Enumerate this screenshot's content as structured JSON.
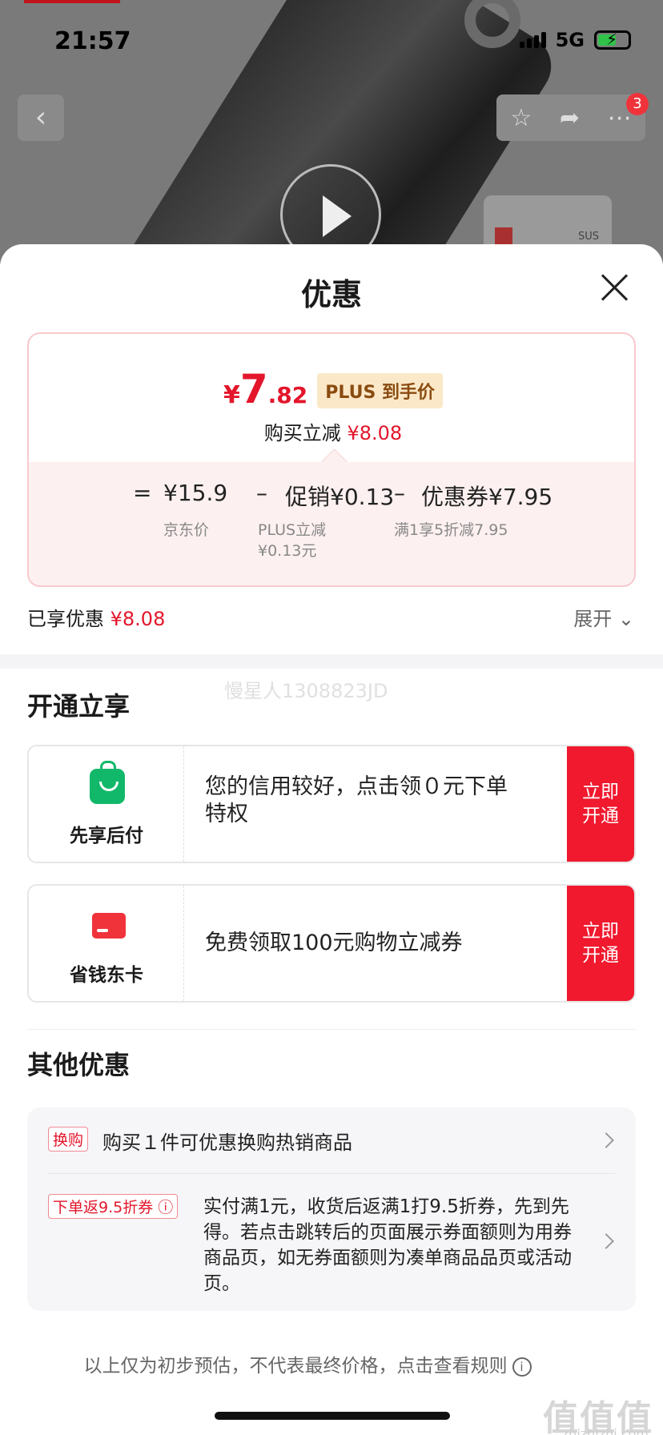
{
  "status_bar": {
    "time": "21:57",
    "network": "5G"
  },
  "product_page": {
    "cart_count": "3",
    "thumb_text": "SUS"
  },
  "sheet": {
    "title": "优惠",
    "price": {
      "currency": "¥",
      "integer": "7",
      "decimal": ".82",
      "tag": "PLUS 到手价"
    },
    "save_label": "购买立减",
    "save_amount": "¥8.08",
    "formula": {
      "equals": "=",
      "base": "¥15.9",
      "minus1": "–",
      "promo": "促销¥0.13",
      "minus2": "–",
      "coupon": "优惠券¥7.95",
      "base_sub": "京东价",
      "promo_sub_1": "PLUS立减",
      "promo_sub_2": "¥0.13元",
      "coupon_sub": "满1享5折减7.95"
    },
    "enjoyed_label": "已享优惠",
    "enjoyed_amount": "¥8.08",
    "expand_label": "展开",
    "watermark": "慢星人1308823JD"
  },
  "open_section": {
    "title": "开通立享",
    "offers": [
      {
        "name": "先享后付",
        "desc": "您的信用较好，点击领０元下单特权",
        "btn_line1": "立即",
        "btn_line2": "开通",
        "icon": "shopping-bag-icon"
      },
      {
        "name": "省钱东卡",
        "desc": "免费领取100元购物立减券",
        "btn_line1": "立即",
        "btn_line2": "开通",
        "icon": "card-icon"
      }
    ]
  },
  "other_section": {
    "title": "其他优惠",
    "items": [
      {
        "tag": "换购",
        "text": "购买１件可优惠换购热销商品"
      },
      {
        "tag": "下单返9.5折券",
        "text": "实付满1元，收货后返满1打9.5折券，先到先得。若点击跳转后的页面展示券面额则为用券商品页，如无券面额则为凑单商品品页或活动页。"
      }
    ]
  },
  "footer": {
    "note": "以上仅为初步预估，不代表最终价格，点击查看规则",
    "site_mark": "值值值",
    "site_url": "zhizhizhi.com"
  },
  "colors": {
    "accent_red": "#e3162b",
    "button_red": "#f0192e",
    "plus_tag_bg": "#fbe8c8",
    "green": "#12b86a"
  }
}
